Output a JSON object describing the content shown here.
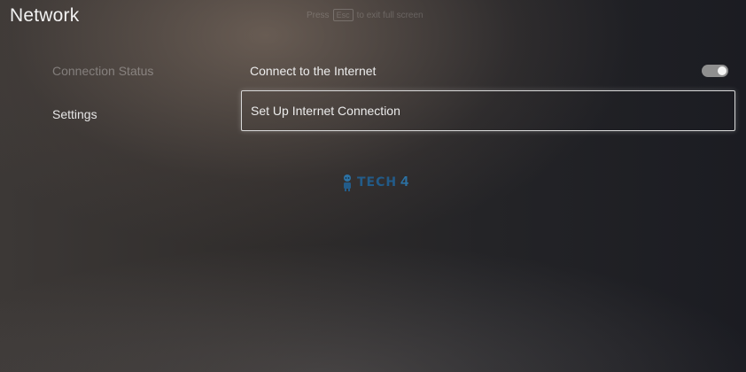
{
  "header": {
    "title": "Network",
    "fullscreen_hint": {
      "prefix": "Press",
      "key": "Esc",
      "suffix": "to exit full screen"
    }
  },
  "sidebar": {
    "items": [
      {
        "label": "Connection Status",
        "state": "dim"
      },
      {
        "label": "Settings",
        "state": "selected"
      }
    ]
  },
  "settings": {
    "connect_label": "Connect to the Internet",
    "connect_toggle_on": true,
    "setup_label": "Set Up Internet Connection"
  },
  "watermark": {
    "text": "TECH",
    "number": "4"
  },
  "colors": {
    "toggle_track": "#8f8f8f",
    "toggle_knob": "#f3f3f3",
    "focus_border": "#d8d8d8",
    "watermark": "#1d6fb0"
  }
}
